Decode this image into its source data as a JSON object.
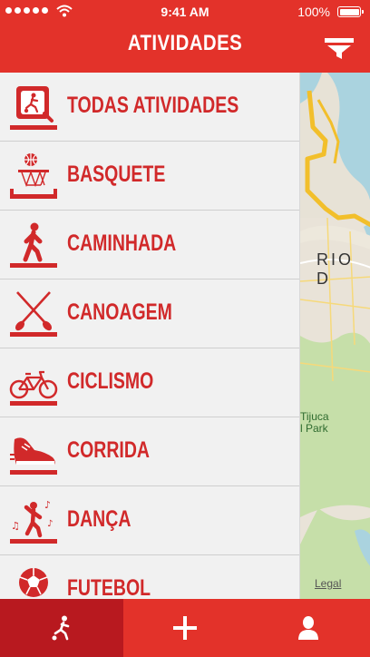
{
  "status": {
    "time": "9:41 AM",
    "battery": "100%"
  },
  "header": {
    "title": "ATIVIDADES"
  },
  "activities": [
    {
      "label": "TODAS ATIVIDADES",
      "icon": "all-activities-icon"
    },
    {
      "label": "BASQUETE",
      "icon": "basketball-icon"
    },
    {
      "label": "CAMINHADA",
      "icon": "walking-icon"
    },
    {
      "label": "CANOAGEM",
      "icon": "canoe-paddles-icon"
    },
    {
      "label": "CICLISMO",
      "icon": "bicycle-icon"
    },
    {
      "label": "CORRIDA",
      "icon": "running-shoe-icon"
    },
    {
      "label": "DANÇA",
      "icon": "dance-icon"
    },
    {
      "label": "FUTEBOL",
      "icon": "soccer-ball-icon"
    }
  ],
  "map": {
    "city_label": "RIO D",
    "park_label_line1": "Tijuca",
    "park_label_line2": "l Park",
    "legal": "Legal"
  },
  "tabs": [
    {
      "name": "activities",
      "icon": "soccer-player-icon",
      "active": true
    },
    {
      "name": "add",
      "icon": "plus-icon",
      "active": false
    },
    {
      "name": "profile",
      "icon": "user-icon",
      "active": false
    }
  ],
  "colors": {
    "primary": "#e3322a",
    "primary_dark": "#b8191f",
    "label": "#d1292a"
  }
}
